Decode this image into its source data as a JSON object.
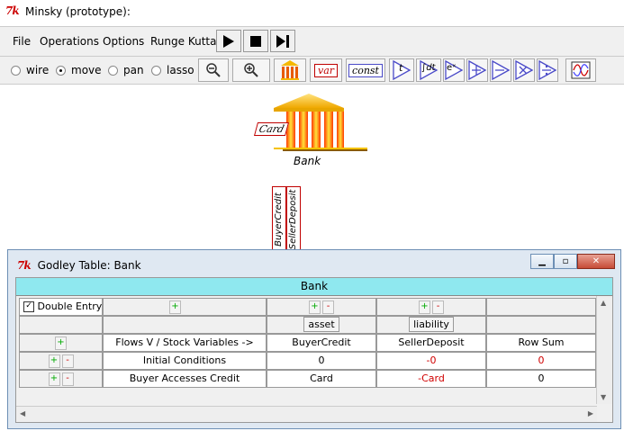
{
  "app": {
    "title": "Minsky (prototype):"
  },
  "menu": {
    "items": [
      "File",
      "Operations",
      "Options",
      "Runge Kutta"
    ],
    "underlines": [
      "F",
      "O",
      "O",
      "R"
    ]
  },
  "modes": {
    "options": [
      "wire",
      "move",
      "pan",
      "lasso"
    ],
    "selected": "move"
  },
  "toolbar": {
    "var_label": "var",
    "const_label": "const",
    "time_label": "t",
    "integrate_label": "∫dt",
    "exp_label": "eˣ",
    "plus_label": "+",
    "minus_label": "−",
    "times_label": "×",
    "divide_label": "÷"
  },
  "canvas": {
    "bank_label": "Bank",
    "card_label": "Card",
    "ports": [
      "BuyerCredit",
      "SellerDeposit"
    ]
  },
  "godley": {
    "window_title": "Godley Table: Bank",
    "table_name": "Bank",
    "double_entry_label": "Double Entry",
    "double_entry_checked": true,
    "asset_label": "asset",
    "liability_label": "liability",
    "header_row_label": "Flows V / Stock Variables ->",
    "columns": [
      "BuyerCredit",
      "SellerDeposit",
      "Row Sum"
    ],
    "rows": [
      {
        "label": "Initial Conditions",
        "values": [
          "0",
          "-0",
          "0"
        ]
      },
      {
        "label": "Buyer Accesses Credit",
        "values": [
          "Card",
          "-Card",
          "0"
        ]
      }
    ],
    "row_sum_colors": [
      "#d00000",
      "#000000"
    ]
  },
  "colors": {
    "bank_bar": "#8fe8ef",
    "accent_blue": "#4a4ac8",
    "var_red": "#c00000"
  }
}
